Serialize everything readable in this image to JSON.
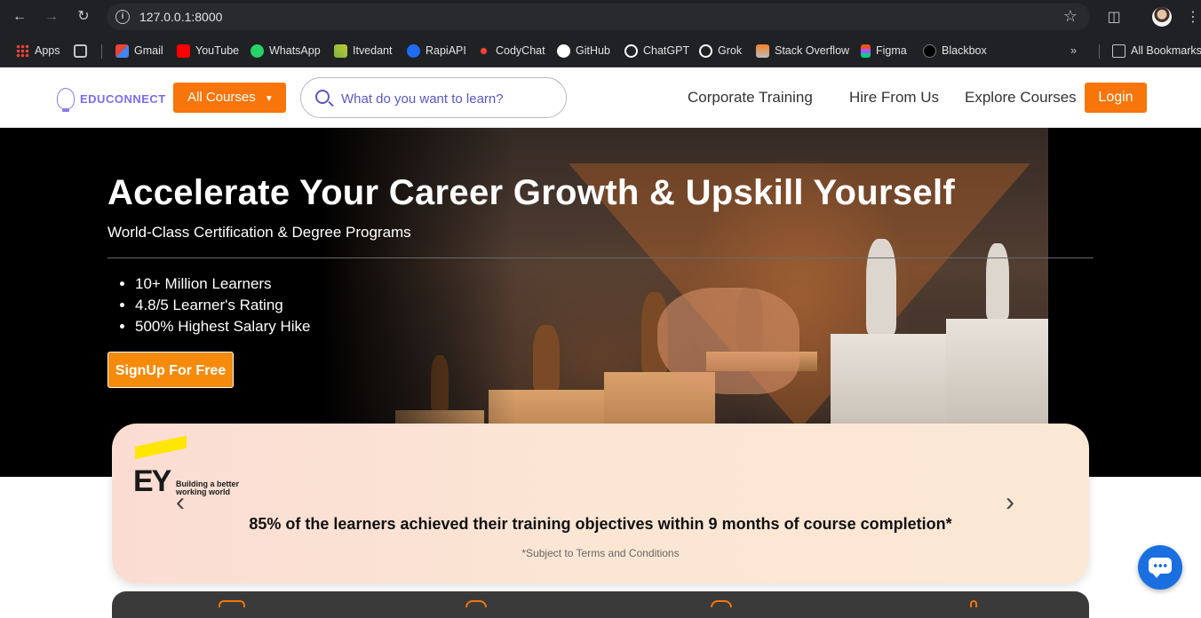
{
  "browser": {
    "url": "127.0.0.1:8000",
    "bookmarks": [
      {
        "label": "Apps",
        "icon": "apps-grid-icon",
        "color": "#ea4335"
      },
      {
        "label": "Gmail",
        "icon": "gmail-icon",
        "color": "#ea4335"
      },
      {
        "label": "YouTube",
        "icon": "youtube-icon",
        "color": "#ff0000"
      },
      {
        "label": "WhatsApp",
        "icon": "whatsapp-icon",
        "color": "#25d366"
      },
      {
        "label": "Itvedant",
        "icon": "itvedant-icon",
        "color": "#7cb342"
      },
      {
        "label": "RapiAPI",
        "icon": "rapiapi-icon",
        "color": "#1e6cf0"
      },
      {
        "label": "CodyChat",
        "icon": "codychat-icon",
        "color": "#f44336"
      },
      {
        "label": "GitHub",
        "icon": "github-icon",
        "color": "#ffffff"
      },
      {
        "label": "ChatGPT",
        "icon": "chatgpt-icon",
        "color": "#ffffff"
      },
      {
        "label": "Grok",
        "icon": "grok-icon",
        "color": "#ffffff"
      },
      {
        "label": "Stack Overflow",
        "icon": "stackoverflow-icon",
        "color": "#f48024"
      },
      {
        "label": "Figma",
        "icon": "figma-icon",
        "color": "#a259ff"
      },
      {
        "label": "Blackbox",
        "icon": "blackbox-icon",
        "color": "#111111"
      }
    ],
    "all_bookmarks": "All Bookmarks"
  },
  "header": {
    "logo_text": "EDUCONNECT",
    "all_courses": "All Courses",
    "search_placeholder": "What do you want to learn?",
    "nav": {
      "corporate": "Corporate Training",
      "hire": "Hire From Us",
      "explore": "Explore Courses"
    },
    "login": "Login"
  },
  "hero": {
    "title": "Accelerate Your Career Growth & Upskill Yourself",
    "subtitle": "World-Class Certification & Degree Programs",
    "bullets": [
      "10+ Million Learners",
      "4.8/5 Learner's Rating",
      "500% Highest Salary Hike"
    ],
    "cta": "SignUp For Free"
  },
  "testimonial": {
    "logo_mark": "EY",
    "logo_tagline_1": "Building a better",
    "logo_tagline_2": "working world",
    "quote": "85% of the learners achieved their training objectives within 9 months of course completion*",
    "terms": "*Subject to Terms and Conditions"
  },
  "colors": {
    "accent": "#f7750b",
    "brand": "#7c6cf0",
    "chat": "#1a6fe0"
  }
}
